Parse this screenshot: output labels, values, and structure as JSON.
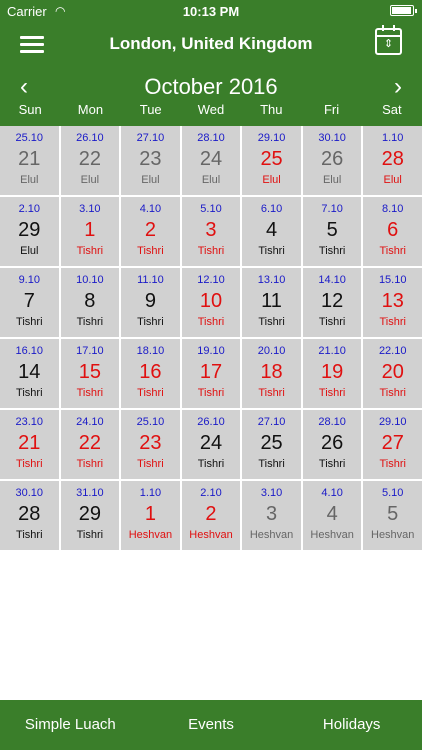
{
  "status": {
    "carrier": "Carrier",
    "time": "10:13 PM"
  },
  "header": {
    "location": "London, United Kingdom",
    "month": "October 2016",
    "prev": "‹",
    "next": "›"
  },
  "weekdays": [
    "Sun",
    "Mon",
    "Tue",
    "Wed",
    "Thu",
    "Fri",
    "Sat"
  ],
  "days": [
    {
      "g": "25.10",
      "h": "21",
      "m": "Elul",
      "t": "gray"
    },
    {
      "g": "26.10",
      "h": "22",
      "m": "Elul",
      "t": "gray"
    },
    {
      "g": "27.10",
      "h": "23",
      "m": "Elul",
      "t": "gray"
    },
    {
      "g": "28.10",
      "h": "24",
      "m": "Elul",
      "t": "gray"
    },
    {
      "g": "29.10",
      "h": "25",
      "m": "Elul",
      "t": "red"
    },
    {
      "g": "30.10",
      "h": "26",
      "m": "Elul",
      "t": "gray"
    },
    {
      "g": "1.10",
      "h": "28",
      "m": "Elul",
      "t": "red"
    },
    {
      "g": "2.10",
      "h": "29",
      "m": "Elul",
      "t": "normal"
    },
    {
      "g": "3.10",
      "h": "1",
      "m": "Tishri",
      "t": "red"
    },
    {
      "g": "4.10",
      "h": "2",
      "m": "Tishri",
      "t": "red"
    },
    {
      "g": "5.10",
      "h": "3",
      "m": "Tishri",
      "t": "red"
    },
    {
      "g": "6.10",
      "h": "4",
      "m": "Tishri",
      "t": "normal"
    },
    {
      "g": "7.10",
      "h": "5",
      "m": "Tishri",
      "t": "normal"
    },
    {
      "g": "8.10",
      "h": "6",
      "m": "Tishri",
      "t": "red"
    },
    {
      "g": "9.10",
      "h": "7",
      "m": "Tishri",
      "t": "normal"
    },
    {
      "g": "10.10",
      "h": "8",
      "m": "Tishri",
      "t": "normal"
    },
    {
      "g": "11.10",
      "h": "9",
      "m": "Tishri",
      "t": "normal"
    },
    {
      "g": "12.10",
      "h": "10",
      "m": "Tishri",
      "t": "red"
    },
    {
      "g": "13.10",
      "h": "11",
      "m": "Tishri",
      "t": "normal"
    },
    {
      "g": "14.10",
      "h": "12",
      "m": "Tishri",
      "t": "normal"
    },
    {
      "g": "15.10",
      "h": "13",
      "m": "Tishri",
      "t": "red"
    },
    {
      "g": "16.10",
      "h": "14",
      "m": "Tishri",
      "t": "normal"
    },
    {
      "g": "17.10",
      "h": "15",
      "m": "Tishri",
      "t": "red"
    },
    {
      "g": "18.10",
      "h": "16",
      "m": "Tishri",
      "t": "red"
    },
    {
      "g": "19.10",
      "h": "17",
      "m": "Tishri",
      "t": "red"
    },
    {
      "g": "20.10",
      "h": "18",
      "m": "Tishri",
      "t": "red"
    },
    {
      "g": "21.10",
      "h": "19",
      "m": "Tishri",
      "t": "red"
    },
    {
      "g": "22.10",
      "h": "20",
      "m": "Tishri",
      "t": "red"
    },
    {
      "g": "23.10",
      "h": "21",
      "m": "Tishri",
      "t": "red"
    },
    {
      "g": "24.10",
      "h": "22",
      "m": "Tishri",
      "t": "red"
    },
    {
      "g": "25.10",
      "h": "23",
      "m": "Tishri",
      "t": "red"
    },
    {
      "g": "26.10",
      "h": "24",
      "m": "Tishri",
      "t": "normal"
    },
    {
      "g": "27.10",
      "h": "25",
      "m": "Tishri",
      "t": "normal"
    },
    {
      "g": "28.10",
      "h": "26",
      "m": "Tishri",
      "t": "normal"
    },
    {
      "g": "29.10",
      "h": "27",
      "m": "Tishri",
      "t": "red"
    },
    {
      "g": "30.10",
      "h": "28",
      "m": "Tishri",
      "t": "normal"
    },
    {
      "g": "31.10",
      "h": "29",
      "m": "Tishri",
      "t": "normal"
    },
    {
      "g": "1.10",
      "h": "1",
      "m": "Heshvan",
      "t": "red"
    },
    {
      "g": "2.10",
      "h": "2",
      "m": "Heshvan",
      "t": "red"
    },
    {
      "g": "3.10",
      "h": "3",
      "m": "Heshvan",
      "t": "gray"
    },
    {
      "g": "4.10",
      "h": "4",
      "m": "Heshvan",
      "t": "gray"
    },
    {
      "g": "5.10",
      "h": "5",
      "m": "Heshvan",
      "t": "gray"
    }
  ],
  "tabs": [
    "Simple Luach",
    "Events",
    "Holidays"
  ],
  "colors": {
    "brand": "#3a7e2a",
    "holiday": "#e01010",
    "gregorian": "#1a1ac8",
    "cell": "#d1d1d1"
  }
}
